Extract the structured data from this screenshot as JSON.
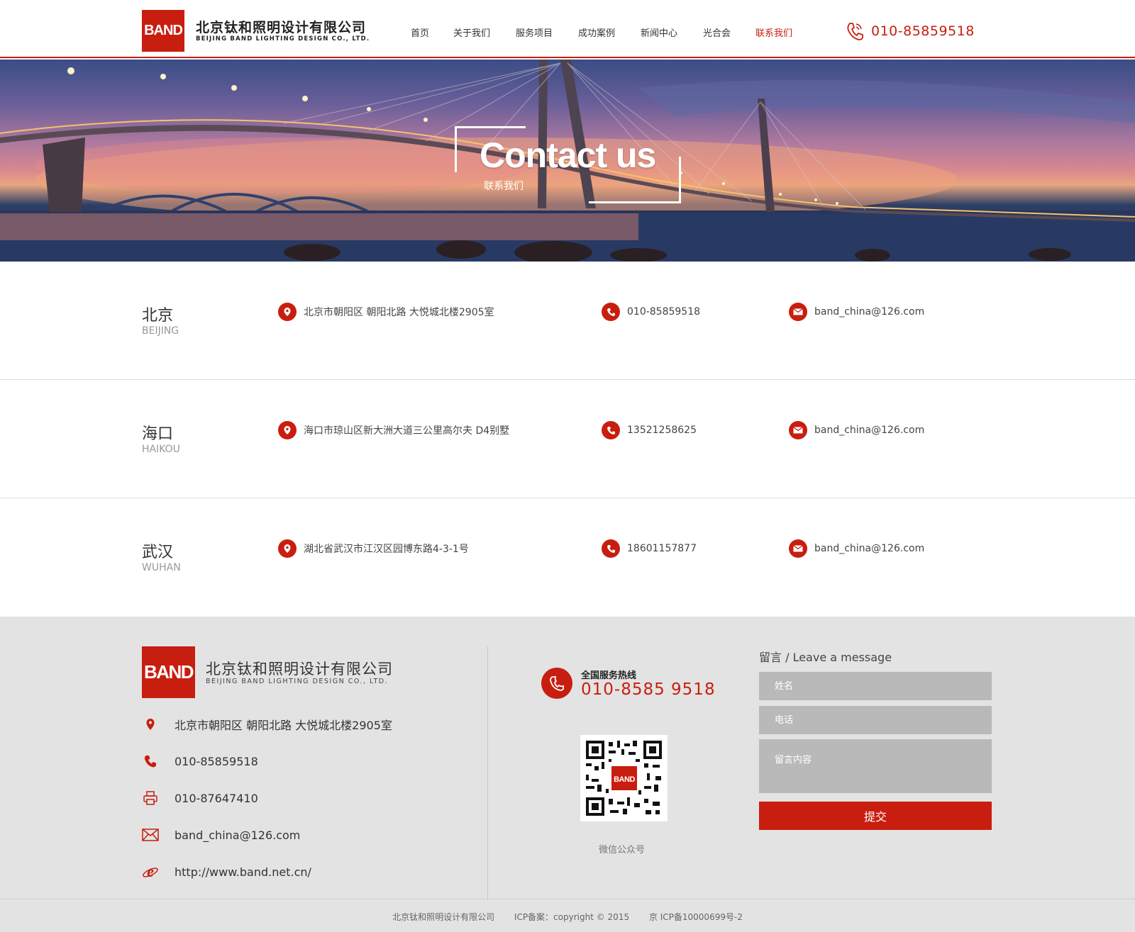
{
  "header": {
    "logo_mark": "BAND",
    "company_cn": "北京钛和照明设计有限公司",
    "company_en": "BEIJING BAND LIGHTING DESIGN CO., LTD.",
    "nav": [
      "首页",
      "关于我们",
      "服务项目",
      "成功案例",
      "新闻中心",
      "光合会",
      "联系我们"
    ],
    "active_nav": "联系我们",
    "phone": "010-85859518"
  },
  "banner": {
    "title": "Contact us",
    "subtitle": "联系我们"
  },
  "offices": [
    {
      "city_cn": "北京",
      "city_en": "BEIJING",
      "address": "北京市朝阳区 朝阳北路 大悦城北楼2905室",
      "phone": "010-85859518",
      "email": "band_china@126.com"
    },
    {
      "city_cn": "海口",
      "city_en": "HAIKOU",
      "address": "海口市琼山区新大洲大道三公里高尔夫 D4别墅",
      "phone": "13521258625",
      "email": "band_china@126.com"
    },
    {
      "city_cn": "武汉",
      "city_en": "WUHAN",
      "address": "湖北省武汉市江汉区园博东路4-3-1号",
      "phone": "18601157877",
      "email": "band_china@126.com"
    }
  ],
  "footer": {
    "logo_mark": "BAND",
    "company_cn": "北京钛和照明设计有限公司",
    "company_en": "BEIJING BAND LIGHTING DESIGN CO., LTD.",
    "contacts": [
      {
        "icon": "location-pin-icon",
        "text": "北京市朝阳区 朝阳北路 大悦城北楼2905室"
      },
      {
        "icon": "phone-icon",
        "text": "010-85859518"
      },
      {
        "icon": "fax-printer-icon",
        "text": "010-87647410"
      },
      {
        "icon": "envelope-icon",
        "text": "band_china@126.com"
      },
      {
        "icon": "ie-browser-icon",
        "text": "http://www.band.net.cn/"
      }
    ],
    "hotline_label": "全国服务热线",
    "hotline_number": "010-8585 9518",
    "qr_mark": "BAND",
    "qr_label": "微信公众号",
    "message": {
      "title": "留言 / Leave a message",
      "name_placeholder": "姓名",
      "phone_placeholder": "电话",
      "content_placeholder": "留言内容",
      "submit": "提交"
    },
    "copyright": {
      "company": "北京钛和照明设计有限公司",
      "icp": "ICP备案：copyright © 2015",
      "license": "京 ICP备10000699号-2"
    }
  },
  "colors": {
    "brand_red": "#c81e0f",
    "footer_bg": "#e3e3e3",
    "input_bg": "#b9b9b9"
  }
}
